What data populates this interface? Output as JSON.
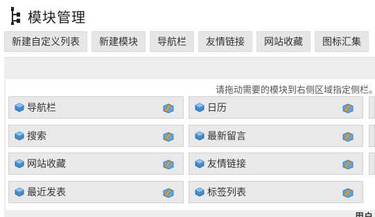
{
  "header": {
    "title": "模块管理"
  },
  "toolbar": [
    {
      "label": "新建自定义列表"
    },
    {
      "label": "新建模块"
    },
    {
      "label": "导航栏"
    },
    {
      "label": "友情链接"
    },
    {
      "label": "网站收藏"
    },
    {
      "label": "图标汇集"
    }
  ],
  "hint": "请拖动需要的模块到右侧区域指定侧栏。",
  "modules": [
    {
      "label": "导航栏"
    },
    {
      "label": "日历"
    },
    {
      "label": "搜索"
    },
    {
      "label": "最新留言"
    },
    {
      "label": "网站收藏"
    },
    {
      "label": "友情链接"
    },
    {
      "label": "最近发表"
    },
    {
      "label": "标签列表"
    }
  ],
  "footer": {
    "text": "用户"
  },
  "colors": {
    "toolbar_bg": "#e6e6e6",
    "module_bg": "#e9e9e9",
    "cube_blue": "#3d8fd1",
    "edit_orange": "#f0a030"
  }
}
